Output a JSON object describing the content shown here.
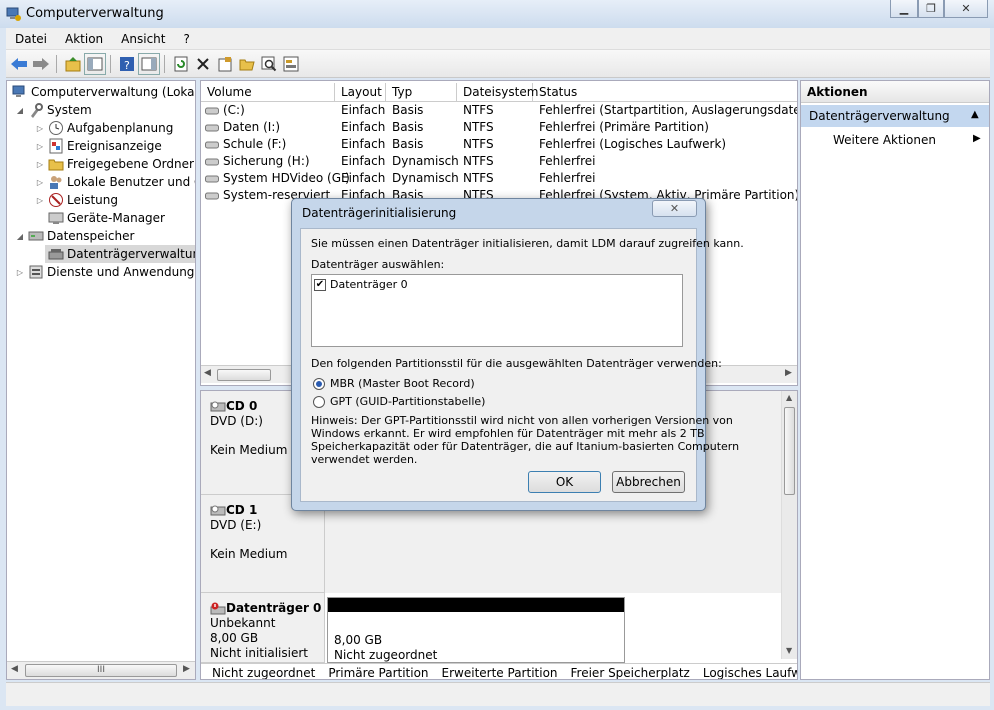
{
  "window": {
    "title": "Computerverwaltung"
  },
  "menu": [
    "Datei",
    "Aktion",
    "Ansicht",
    "?"
  ],
  "tree": {
    "items": [
      {
        "label": "Computerverwaltung (Lokal)"
      },
      {
        "label": "System"
      },
      {
        "label": "Aufgabenplanung"
      },
      {
        "label": "Ereignisanzeige"
      },
      {
        "label": "Freigegebene Ordner"
      },
      {
        "label": "Lokale Benutzer und Gruppen"
      },
      {
        "label": "Leistung"
      },
      {
        "label": "Geräte-Manager"
      },
      {
        "label": "Datenspeicher"
      },
      {
        "label": "Datenträgerverwaltung"
      },
      {
        "label": "Dienste und Anwendungen"
      }
    ],
    "scroll_thumb_label": "III"
  },
  "volumes": {
    "columns": [
      "Volume",
      "Layout",
      "Typ",
      "Dateisystem",
      "Status"
    ],
    "rows": [
      [
        "(C:)",
        "Einfach",
        "Basis",
        "NTFS",
        "Fehlerfrei (Startpartition, Auslagerungsdatei, Abs"
      ],
      [
        "Daten (I:)",
        "Einfach",
        "Basis",
        "NTFS",
        "Fehlerfrei (Primäre Partition)"
      ],
      [
        "Schule (F:)",
        "Einfach",
        "Basis",
        "NTFS",
        "Fehlerfrei (Logisches Laufwerk)"
      ],
      [
        "Sicherung (H:)",
        "Einfach",
        "Dynamisch",
        "NTFS",
        "Fehlerfrei"
      ],
      [
        "System HDVideo (G:)",
        "Einfach",
        "Dynamisch",
        "NTFS",
        "Fehlerfrei"
      ],
      [
        "System-reserviert",
        "Einfach",
        "Basis",
        "NTFS",
        "Fehlerfrei (System, Aktiv, Primäre Partition)"
      ]
    ]
  },
  "disks": [
    {
      "name": "CD 0",
      "line1": "DVD (D:)",
      "line2": "Kein Medium"
    },
    {
      "name": "CD 1",
      "line1": "DVD (E:)",
      "line2": "Kein Medium"
    },
    {
      "name": "Datenträger 0",
      "line1": "Unbekannt",
      "line2": "8,00 GB",
      "line3": "Nicht initialisiert",
      "part_size": "8,00 GB",
      "part_status": "Nicht zugeordnet"
    }
  ],
  "legend": [
    {
      "label": "Nicht zugeordnet",
      "color": "#000000"
    },
    {
      "label": "Primäre Partition",
      "color": "#000080"
    },
    {
      "label": "Erweiterte Partition",
      "color": "#008000"
    },
    {
      "label": "Freier Speicherplatz",
      "color": "#00e000"
    },
    {
      "label": "Logisches Laufwerk",
      "color": "#0000ff"
    }
  ],
  "actions": {
    "header": "Aktionen",
    "section": "Datenträgerverwaltung",
    "more": "Weitere Aktionen"
  },
  "dialog": {
    "title": "Datenträgerinitialisierung",
    "intro": "Sie müssen einen Datenträger initialisieren, damit LDM darauf zugreifen kann.",
    "select_label": "Datenträger auswählen:",
    "disk_item": "Datenträger 0",
    "disk_checked": true,
    "style_label": "Den folgenden Partitionsstil für die ausgewählten Datenträger verwenden:",
    "mbr_label": "MBR (Master Boot Record)",
    "gpt_label": "GPT (GUID-Partitionstabelle)",
    "selected_style": "MBR",
    "hint_lines": [
      "Hinweis: Der GPT-Partitionsstil wird nicht von allen vorherigen Versionen von",
      "Windows erkannt. Er wird empfohlen für Datenträger mit mehr als 2 TB",
      "Speicherkapazität oder für Datenträger, die auf Itanium-basierten Computern",
      "verwendet werden."
    ],
    "ok_label": "OK",
    "cancel_label": "Abbrechen"
  }
}
